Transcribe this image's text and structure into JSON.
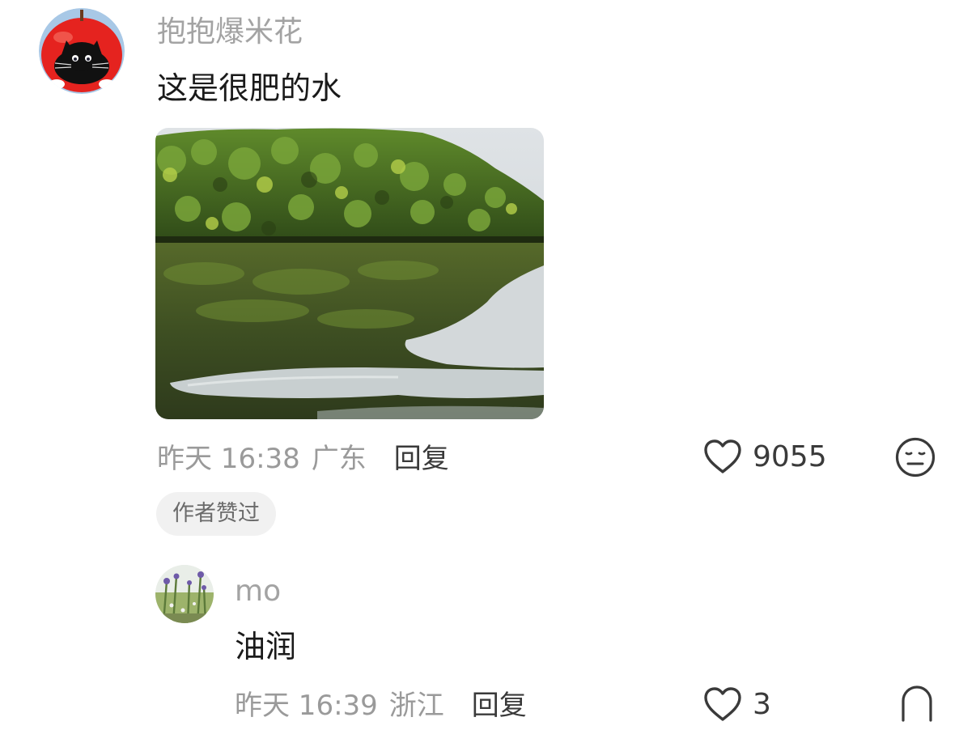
{
  "main_comment": {
    "username": "抱抱爆米花",
    "text": "这是很肥的水",
    "time": "昨天 16:38",
    "region": "广东",
    "reply_label": "回复",
    "like_count": "9055",
    "author_tag": "作者赞过",
    "avatar_icon": "red-apple-black-cat-avatar",
    "image_subject": "forested-hill-reflected-in-green-river"
  },
  "reply_comment": {
    "username": "mo",
    "text": "油润",
    "time": "昨天 16:39",
    "region": "浙江",
    "reply_label": "回复",
    "like_count": "3",
    "avatar_icon": "meadow-flowers-avatar"
  },
  "icons": {
    "like": "heart-outline-icon",
    "emoji": "meh-face-icon"
  },
  "colors": {
    "username": "#a3a3a3",
    "text": "#1a1a1a",
    "meta": "#9a9a9a",
    "reply": "#3a3a3a",
    "tag_bg": "#f1f1f1"
  }
}
